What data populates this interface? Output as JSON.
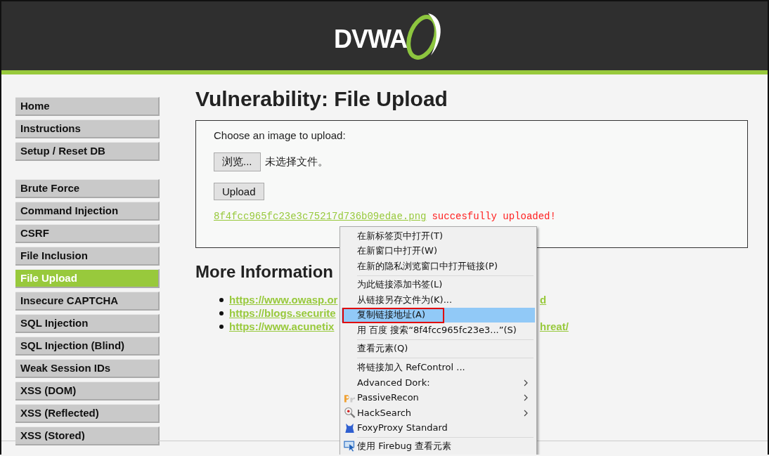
{
  "header": {
    "logo": "DVWA"
  },
  "sidebar": {
    "groups": [
      [
        {
          "label": "Home",
          "selected": false
        },
        {
          "label": "Instructions",
          "selected": false
        },
        {
          "label": "Setup / Reset DB",
          "selected": false
        }
      ],
      [
        {
          "label": "Brute Force",
          "selected": false
        },
        {
          "label": "Command Injection",
          "selected": false
        },
        {
          "label": "CSRF",
          "selected": false
        },
        {
          "label": "File Inclusion",
          "selected": false
        },
        {
          "label": "File Upload",
          "selected": true
        },
        {
          "label": "Insecure CAPTCHA",
          "selected": false
        },
        {
          "label": "SQL Injection",
          "selected": false
        },
        {
          "label": "SQL Injection (Blind)",
          "selected": false
        },
        {
          "label": "Weak Session IDs",
          "selected": false
        },
        {
          "label": "XSS (DOM)",
          "selected": false
        },
        {
          "label": "XSS (Reflected)",
          "selected": false
        },
        {
          "label": "XSS (Stored)",
          "selected": false
        }
      ]
    ]
  },
  "main": {
    "title": "Vulnerability: File Upload",
    "upload_form": {
      "prompt": "Choose an image to upload:",
      "browse_button": "浏览...",
      "file_status": "未选择文件。",
      "upload_button": "Upload",
      "result_link": "8f4fcc965fc23e3c75217d736b09edae.png",
      "result_message": "succesfully uploaded!"
    },
    "more_info": {
      "title": "More Information",
      "links": [
        {
          "left": "https://www.owasp.or",
          "right": "d"
        },
        {
          "left": "https://blogs.securite"
        },
        {
          "left": "https://www.acunetix",
          "right": "hreat/"
        }
      ]
    }
  },
  "context_menu": {
    "items": [
      {
        "kind": "item",
        "label": "在新标签页中打开(T)",
        "selected": false,
        "submenu": false
      },
      {
        "kind": "item",
        "label": "在新窗口中打开(W)",
        "selected": false,
        "submenu": false
      },
      {
        "kind": "item",
        "label": "在新的隐私浏览窗口中打开链接(P)",
        "selected": false,
        "submenu": false
      },
      {
        "kind": "separator"
      },
      {
        "kind": "item",
        "label": "为此链接添加书签(L)",
        "selected": false,
        "submenu": false
      },
      {
        "kind": "item",
        "label": "从链接另存文件为(K)...",
        "selected": false,
        "submenu": false
      },
      {
        "kind": "item",
        "label": "复制链接地址(A)",
        "selected": true,
        "submenu": false,
        "annotated": true
      },
      {
        "kind": "item",
        "label": "用 百度 搜索“8f4fcc965fc23e3...”(S)",
        "selected": false,
        "submenu": false
      },
      {
        "kind": "separator"
      },
      {
        "kind": "item",
        "label": "查看元素(Q)",
        "selected": false,
        "submenu": false
      },
      {
        "kind": "separator"
      },
      {
        "kind": "item",
        "label": "将链接加入 RefControl ...",
        "selected": false,
        "submenu": false
      },
      {
        "kind": "item",
        "label": "Advanced Dork:",
        "selected": false,
        "submenu": true
      },
      {
        "kind": "item",
        "label": "PassiveRecon",
        "selected": false,
        "submenu": true
      },
      {
        "kind": "item",
        "label": "HackSearch",
        "selected": false,
        "submenu": true
      },
      {
        "kind": "item",
        "label": "FoxyProxy Standard",
        "selected": false,
        "submenu": false
      },
      {
        "kind": "separator"
      },
      {
        "kind": "item",
        "label": "使用 Firebug 查看元素",
        "selected": false,
        "submenu": false
      }
    ]
  }
}
